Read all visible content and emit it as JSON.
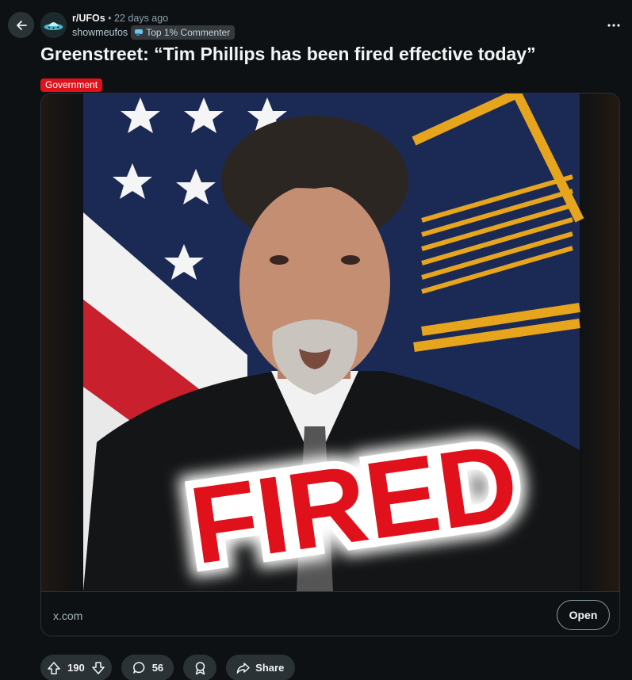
{
  "header": {
    "back_icon": "arrow-left-icon",
    "subreddit": "r/UFOs",
    "separator": "•",
    "age": "22 days ago",
    "username": "showmeufos",
    "user_flair": "Top 1% Commenter",
    "more_icon": "ellipsis-icon"
  },
  "post": {
    "title": "Greenstreet: “Tim Phillips has been fired effective today”",
    "flair": "Government",
    "flair_color": "#e0111b",
    "image_caption": "FIRED"
  },
  "link": {
    "domain": "x.com",
    "open_label": "Open"
  },
  "actions": {
    "score": "190",
    "comments": "56",
    "share_label": "Share"
  },
  "colors": {
    "background": "#0e1113",
    "pill": "#2a3236",
    "accent_red": "#e0111b"
  }
}
